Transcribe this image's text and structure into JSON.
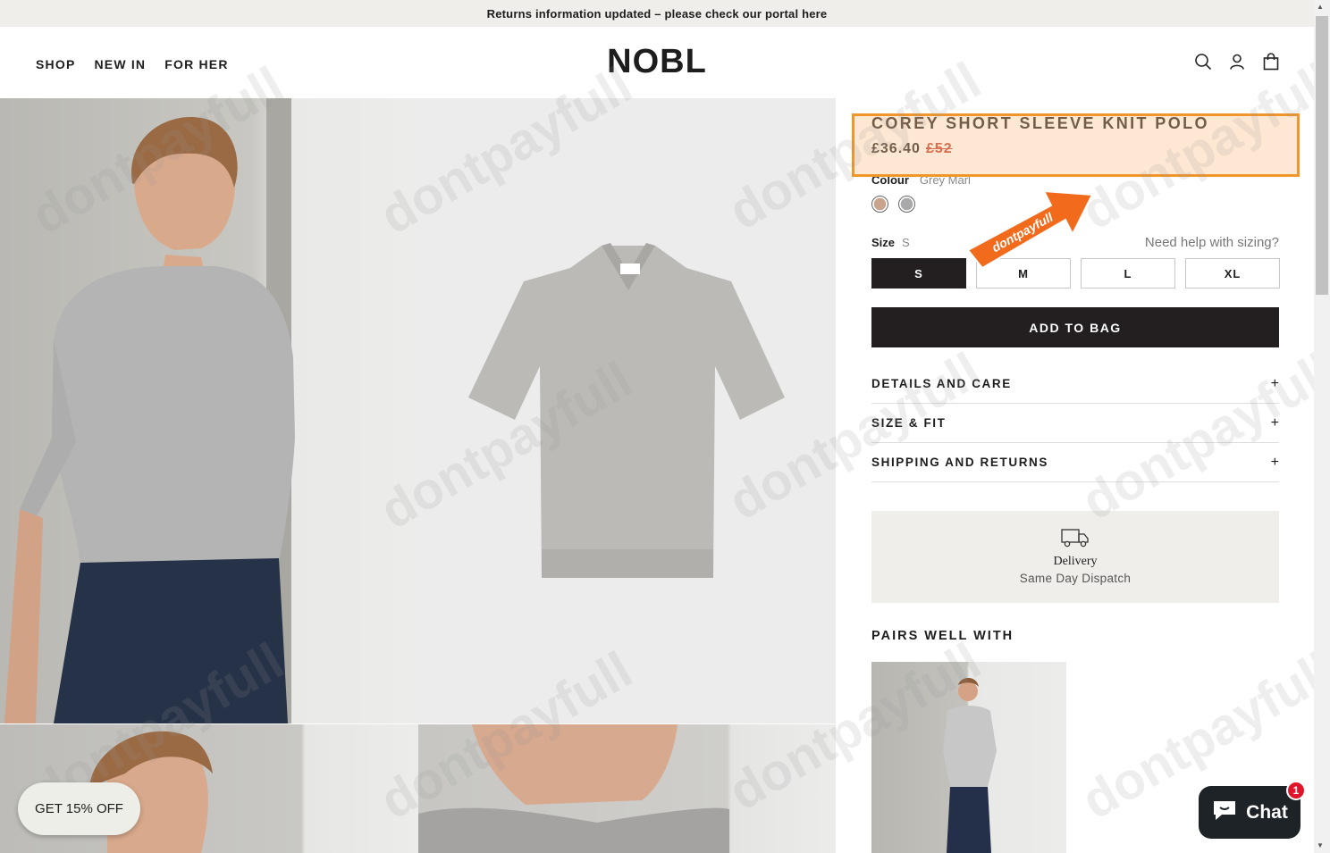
{
  "announcement": "Returns information updated – please check our portal here",
  "nav": {
    "shop": "SHOP",
    "new_in": "NEW IN",
    "for_her": "FOR HER"
  },
  "logo": "NOBL",
  "product": {
    "title": "COREY SHORT SLEEVE KNIT POLO",
    "price": "£36.40",
    "original_price": "£52",
    "colour_label": "Colour",
    "colour_value": "Grey Marl",
    "size_label": "Size",
    "size_value": "S",
    "size_help": "Need help with sizing?",
    "sizes": [
      "S",
      "M",
      "L",
      "XL"
    ],
    "add_to_bag": "ADD TO BAG",
    "accordions": [
      "DETAILS AND CARE",
      "SIZE & FIT",
      "SHIPPING AND RETURNS"
    ],
    "delivery_title": "Delivery",
    "delivery_text": "Same Day Dispatch",
    "pairs_title": "PAIRS WELL WITH"
  },
  "overlay": {
    "arrow_text": "dontpayfull",
    "watermark": "dontpayfull"
  },
  "promo": "GET 15% OFF",
  "chat": {
    "label": "Chat",
    "badge": "1"
  },
  "colors": {
    "accent": "#231f20",
    "highlight": "#f0962a",
    "sale": "#c0392b"
  }
}
